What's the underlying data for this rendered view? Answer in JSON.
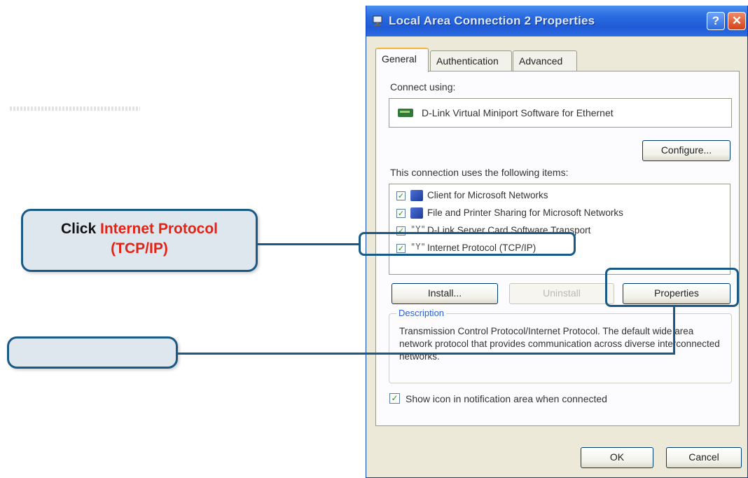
{
  "window": {
    "title": "Local Area Connection 2 Properties",
    "help_label": "?",
    "close_label": "✕"
  },
  "tabs": [
    {
      "label": "General"
    },
    {
      "label": "Authentication"
    },
    {
      "label": "Advanced"
    }
  ],
  "general": {
    "connect_using_label": "Connect using:",
    "adapter_name": "D-Link Virtual Miniport Software for Ethernet",
    "configure_label": "Configure...",
    "items_label": "This connection uses the following items:",
    "items": [
      {
        "label": "Client for Microsoft Networks",
        "checked": true,
        "icon": "network-client-icon"
      },
      {
        "label": "File and Printer Sharing for Microsoft Networks",
        "checked": true,
        "icon": "file-printer-sharing-icon"
      },
      {
        "label": "D-Link Server Card Software Transport",
        "checked": true,
        "icon": "protocol-icon"
      },
      {
        "label": "Internet Protocol (TCP/IP)",
        "checked": true,
        "icon": "protocol-icon"
      }
    ],
    "protocol_glyph": "\"Y\"",
    "install_label": "Install...",
    "uninstall_label": "Uninstall",
    "properties_label": "Properties",
    "description_legend": "Description",
    "description_text": "Transmission Control Protocol/Internet Protocol. The default wide area network protocol that provides communication across diverse interconnected networks.",
    "show_icon_label": "Show icon in notification area when connected",
    "show_icon_checked": true
  },
  "buttons": {
    "ok_label": "OK",
    "cancel_label": "Cancel"
  },
  "callouts": {
    "first_prefix": "Click ",
    "first_highlight": "Internet Protocol",
    "first_second_line": "(TCP/IP)",
    "second_text": ""
  },
  "colors": {
    "callout_border": "#1b5a86",
    "callout_fill": "#dfe7ee",
    "callout_red": "#e22316",
    "titlebar": "#2a6be0"
  }
}
